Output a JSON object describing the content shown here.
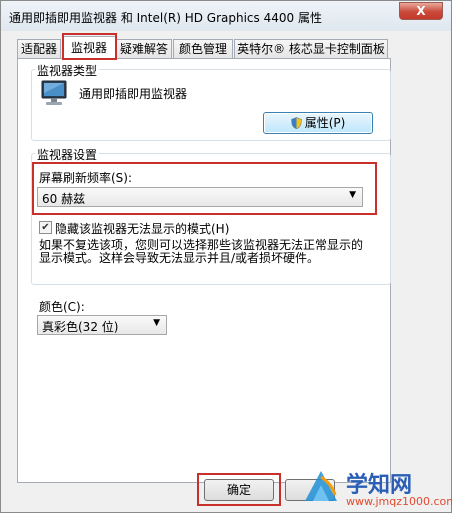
{
  "window": {
    "title": "通用即插即用监视器 和 Intel(R) HD Graphics 4400 属性",
    "close_label": "X"
  },
  "tabs": [
    {
      "label": "适配器",
      "active": false
    },
    {
      "label": "监视器",
      "active": true
    },
    {
      "label": "疑难解答",
      "active": false
    },
    {
      "label": "颜色管理",
      "active": false
    },
    {
      "label": "英特尔® 核芯显卡控制面板",
      "active": false
    }
  ],
  "monitor_type": {
    "group_label": "监视器类型",
    "device_name": "通用即插即用监视器",
    "properties_button": "属性(P)",
    "icon": "monitor-icon"
  },
  "monitor_settings": {
    "group_label": "监视器设置",
    "refresh_label": "屏幕刷新频率(S):",
    "refresh_value": "60 赫兹",
    "hide_modes_label": "隐藏该监视器无法显示的模式(H)",
    "hide_modes_checked": true,
    "description_line1": "如果不复选该项，您则可以选择那些该监视器无法正常显示的",
    "description_line2": "显示模式。这样会导致无法显示并且/或者损坏硬件。"
  },
  "colors": {
    "label": "颜色(C):",
    "value": "真彩色(32 位)"
  },
  "footer": {
    "ok_button": "确定",
    "cancel_button_fragment": ""
  },
  "watermark": {
    "title": "学知网",
    "url": "www.jmqz1000.com"
  },
  "accent_colors": {
    "highlight_red": "#c9302c",
    "watermark_blue": "#2a5fb5",
    "watermark_orange": "#e24a2f"
  }
}
